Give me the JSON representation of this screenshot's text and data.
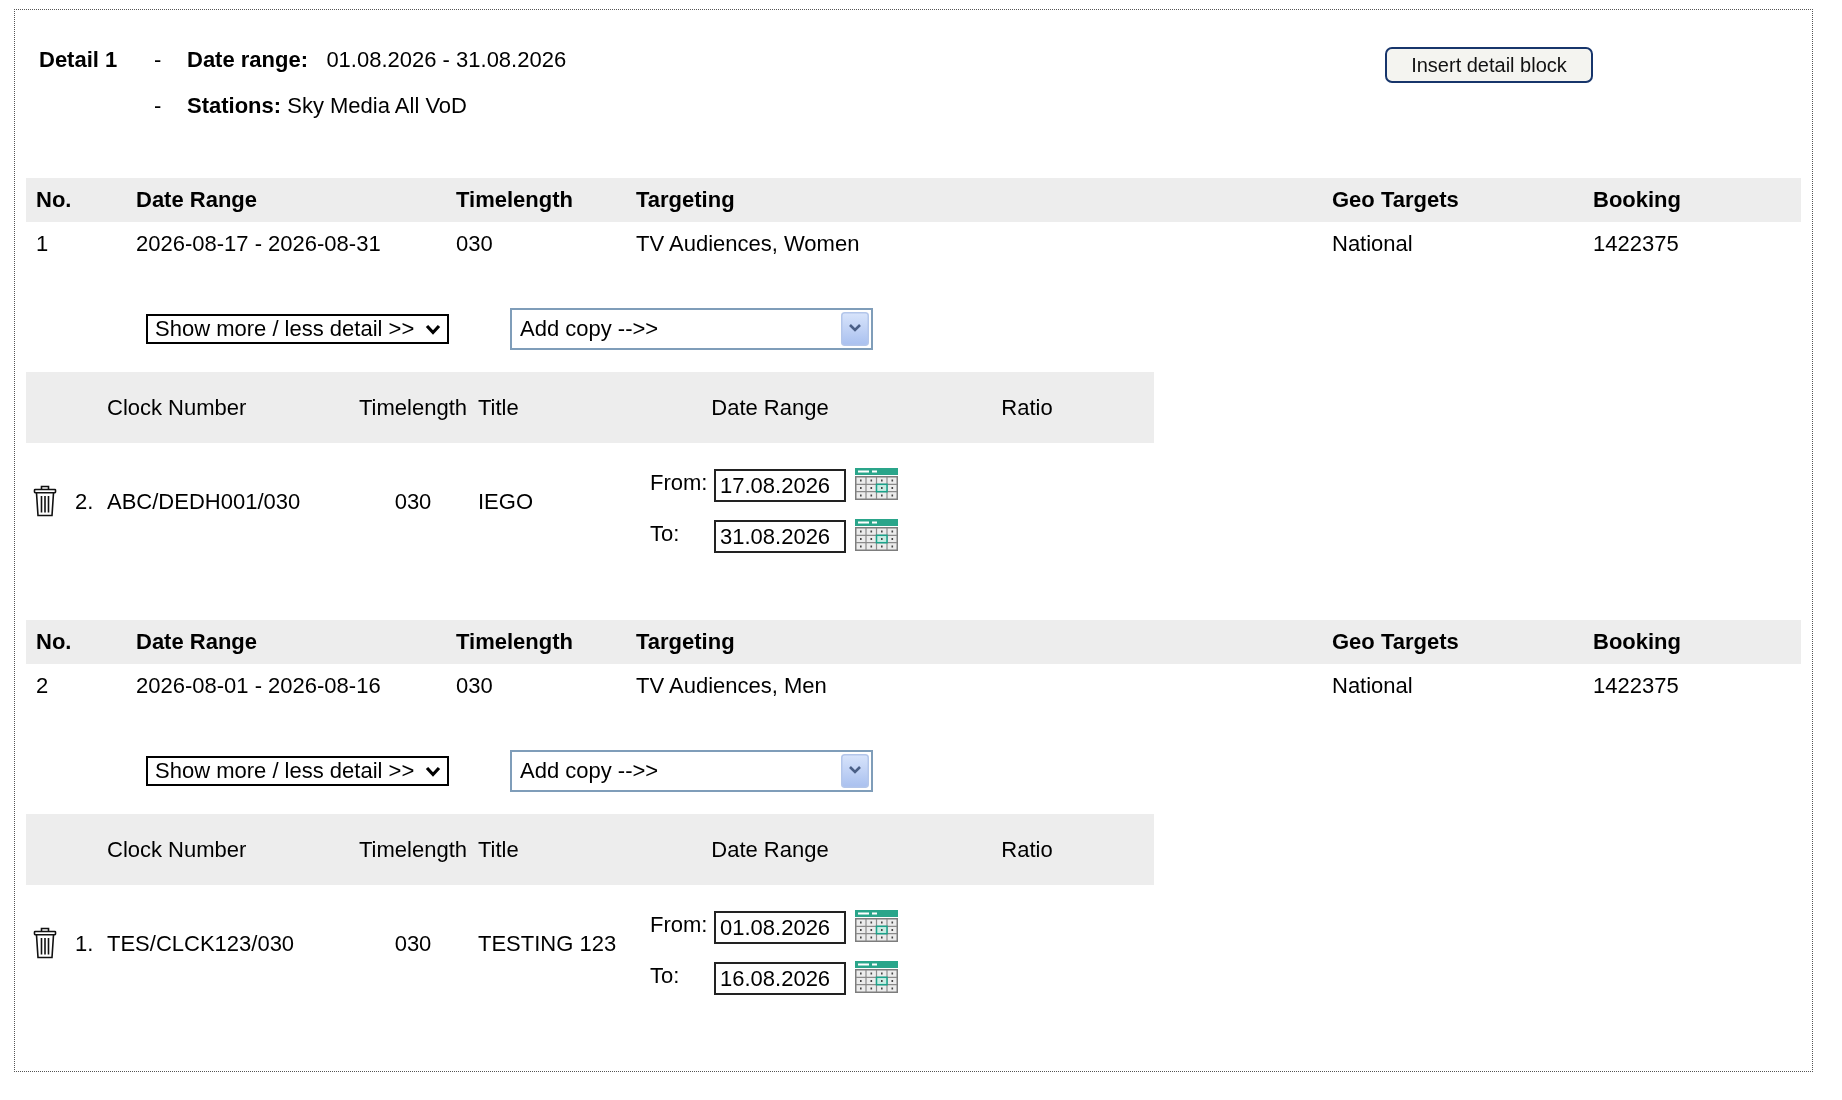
{
  "detail": {
    "title": "Detail 1",
    "lines": [
      {
        "bullet": "-",
        "text": "**Date range:**   01.08.2026 - 31.08.2026"
      },
      {
        "bullet": "-",
        "text": "**Stations:** Sky Media All VoD"
      }
    ],
    "insert_button": "Insert detail block"
  },
  "sections": [
    {
      "table": {
        "columns": [
          "No.",
          "Date Range",
          "Timelength",
          "Targeting",
          "Geo Targets",
          "Booking"
        ],
        "rows": [
          {
            "cells": [
              "1",
              "2026-08-17 - 2026-08-31",
              "030",
              "TV Audiences, Women",
              "National",
              "1422375"
            ]
          }
        ]
      },
      "detail_select": "Show more / less detail >>",
      "copy_select": "Add copy -->>",
      "copies": {
        "columns": [
          "Clock Number",
          "Timelength",
          "Title",
          "Date Range",
          "Ratio"
        ],
        "rows": [
          {
            "index": "2.",
            "clock_number": "ABC/DEDH001/030",
            "timelength": "030",
            "title": "IEGO",
            "dates": [
              {
                "label": "From:",
                "value": "17.08.2026"
              },
              {
                "label": "To:",
                "value": "31.08.2026"
              }
            ]
          }
        ]
      }
    },
    {
      "table": {
        "columns": [
          "No.",
          "Date Range",
          "Timelength",
          "Targeting",
          "Geo Targets",
          "Booking"
        ],
        "rows": [
          {
            "cells": [
              "2",
              "2026-08-01 - 2026-08-16",
              "030",
              "TV Audiences, Men",
              "National",
              "1422375"
            ]
          }
        ]
      },
      "detail_select": "Show more / less detail >>",
      "copy_select": "Add copy -->>",
      "copies": {
        "columns": [
          "Clock Number",
          "Timelength",
          "Title",
          "Date Range",
          "Ratio"
        ],
        "rows": [
          {
            "index": "1.",
            "clock_number": "TES/CLCK123/030",
            "timelength": "030",
            "title": "TESTING 123",
            "dates": [
              {
                "label": "From:",
                "value": "01.08.2026"
              },
              {
                "label": "To:",
                "value": "16.08.2026"
              }
            ]
          }
        ]
      }
    }
  ]
}
